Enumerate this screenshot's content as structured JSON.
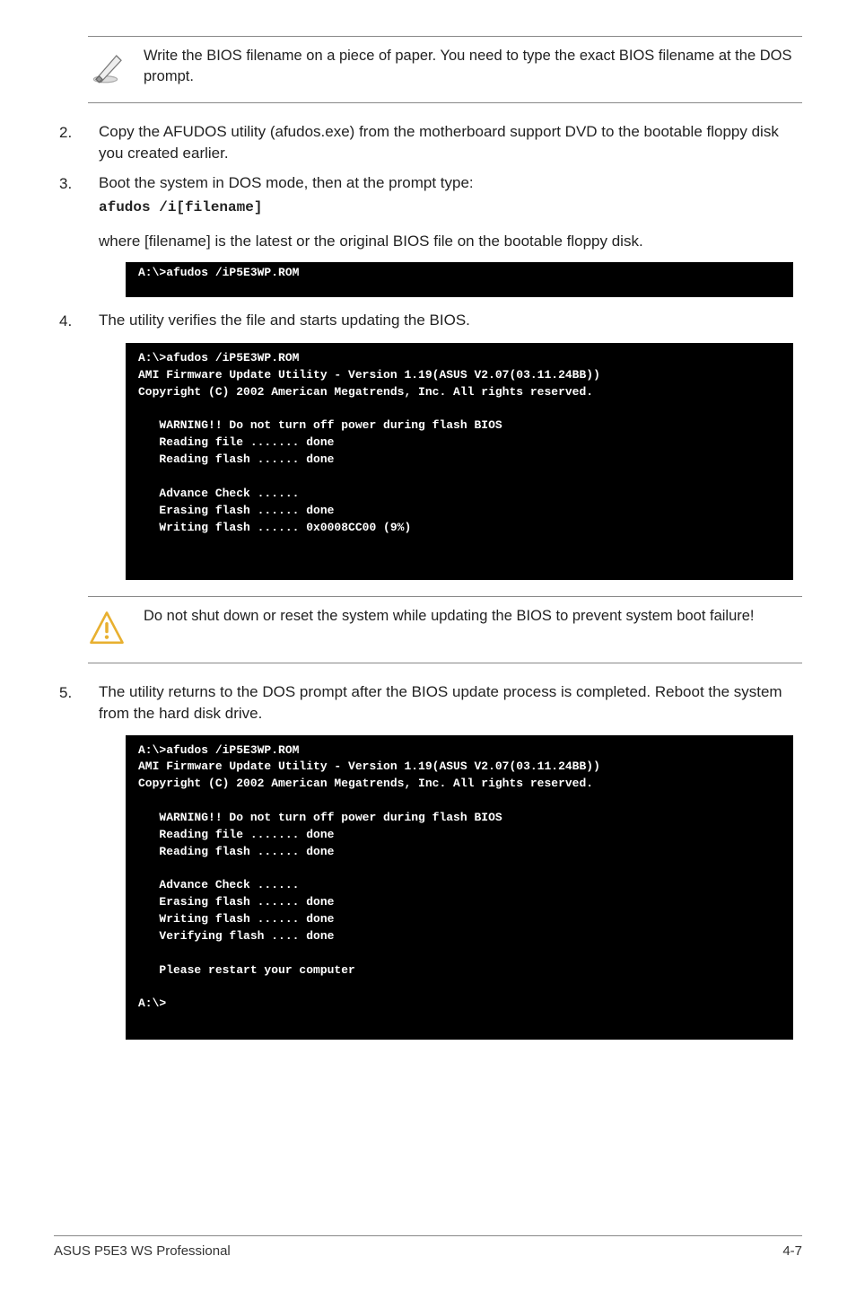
{
  "note1": "Write the BIOS filename on a piece of paper. You need to type the exact BIOS filename at the DOS prompt.",
  "step2_num": "2.",
  "step2_text": "Copy the AFUDOS utility (afudos.exe) from the motherboard support DVD to the bootable floppy disk you created earlier.",
  "step3_num": "3.",
  "step3_text": "Boot the system in DOS mode, then at the prompt type:",
  "step3_code": "afudos /i[filename]",
  "step3_sub": "where [filename] is the latest or the original BIOS file on the bootable floppy disk.",
  "terminal1": "A:\\>afudos /iP5E3WP.ROM",
  "step4_num": "4.",
  "step4_text": "The utility verifies the file and starts updating the BIOS.",
  "terminal2": "A:\\>afudos /iP5E3WP.ROM\nAMI Firmware Update Utility - Version 1.19(ASUS V2.07(03.11.24BB))\nCopyright (C) 2002 American Megatrends, Inc. All rights reserved.\n\n   WARNING!! Do not turn off power during flash BIOS\n   Reading file ....... done\n   Reading flash ...... done\n\n   Advance Check ......\n   Erasing flash ...... done\n   Writing flash ...... 0x0008CC00 (9%)\n\n",
  "note2": "Do not shut down or reset the system while updating the BIOS to prevent system boot failure!",
  "step5_num": "5.",
  "step5_text": "The utility returns to the DOS prompt after the BIOS update process is completed. Reboot the system from the hard disk drive.",
  "terminal3": "A:\\>afudos /iP5E3WP.ROM\nAMI Firmware Update Utility - Version 1.19(ASUS V2.07(03.11.24BB))\nCopyright (C) 2002 American Megatrends, Inc. All rights reserved.\n\n   WARNING!! Do not turn off power during flash BIOS\n   Reading file ....... done\n   Reading flash ...... done\n\n   Advance Check ......\n   Erasing flash ...... done\n   Writing flash ...... done\n   Verifying flash .... done\n\n   Please restart your computer\n\nA:\\>",
  "footer_left": "ASUS P5E3 WS Professional",
  "footer_right": "4-7"
}
